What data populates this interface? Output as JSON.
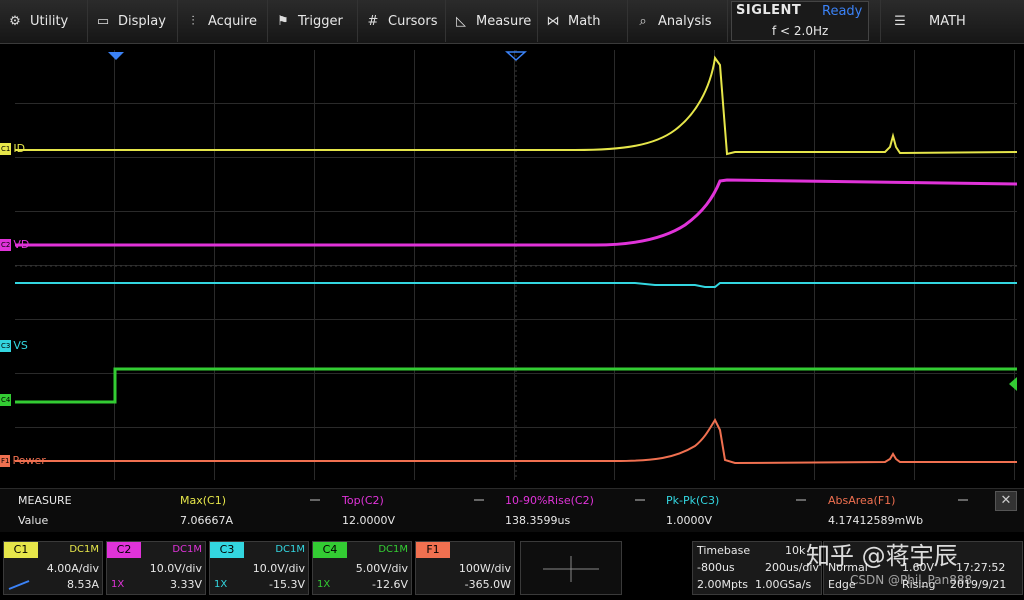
{
  "menu": [
    {
      "label": "Utility",
      "icon": "gear-icon",
      "glyph": "⚙"
    },
    {
      "label": "Display",
      "icon": "monitor-icon",
      "glyph": "▭"
    },
    {
      "label": "Acquire",
      "icon": "acquire-icon",
      "glyph": "⫶"
    },
    {
      "label": "Trigger",
      "icon": "flag-icon",
      "glyph": "⚑"
    },
    {
      "label": "Cursors",
      "icon": "cursors-icon",
      "glyph": "#"
    },
    {
      "label": "Measure",
      "icon": "measure-icon",
      "glyph": "◺"
    },
    {
      "label": "Math",
      "icon": "math-icon",
      "glyph": "⋈"
    },
    {
      "label": "Analysis",
      "icon": "analysis-icon",
      "glyph": "⌕"
    }
  ],
  "brand": {
    "logo": "SIGLENT",
    "status": "Ready",
    "freq": "f < 2.0Hz"
  },
  "math_menu": {
    "label": "MATH",
    "icon": "list-icon",
    "glyph": "☰"
  },
  "colors": {
    "c1": "#e6e64a",
    "c2": "#e033d9",
    "c3": "#33d6e0",
    "c4": "#33cc33",
    "f1": "#f07050",
    "accent": "#3b82f6"
  },
  "channels_labels": {
    "c1": "ID",
    "c2": "VD",
    "c3": "VS",
    "c4": "",
    "f1": "Power"
  },
  "channel_tags": {
    "c1": "C1",
    "c2": "C2",
    "c3": "C3",
    "c4": "C4",
    "f1": "F1"
  },
  "measure": {
    "title": "MEASURE",
    "row_label": "Value",
    "items": [
      {
        "name": "Max(C1)",
        "value": "7.06667A",
        "color": "#e6e64a"
      },
      {
        "name": "Top(C2)",
        "value": "12.0000V",
        "color": "#e033d9"
      },
      {
        "name": "10-90%Rise(C2)",
        "value": "138.3599us",
        "color": "#e033d9"
      },
      {
        "name": "Pk-Pk(C3)",
        "value": "1.0000V",
        "color": "#33d6e0"
      },
      {
        "name": "AbsArea(F1)",
        "value": "4.17412589mWb",
        "color": "#f07050"
      }
    ],
    "close": "✕"
  },
  "chboxes": [
    {
      "name": "C1",
      "coupling": "DC1M",
      "scale": "4.00A/div",
      "offset": "8.53A",
      "probe": "",
      "color": "#e6e64a"
    },
    {
      "name": "C2",
      "coupling": "DC1M",
      "scale": "10.0V/div",
      "offset": "3.33V",
      "probe": "1X",
      "color": "#e033d9"
    },
    {
      "name": "C3",
      "coupling": "DC1M",
      "scale": "10.0V/div",
      "offset": "-15.3V",
      "probe": "1X",
      "color": "#33d6e0"
    },
    {
      "name": "C4",
      "coupling": "DC1M",
      "scale": "5.00V/div",
      "offset": "-12.6V",
      "probe": "1X",
      "color": "#33cc33"
    },
    {
      "name": "F1",
      "coupling": "",
      "scale": "100W/div",
      "offset": "-365.0W",
      "probe": "",
      "color": "#f07050"
    }
  ],
  "timebase": {
    "title": "Timebase",
    "mpts_val": "10k",
    "delay": "-800us",
    "scale": "200us/div",
    "mpts": "2.00Mpts",
    "rate": "1.00GSa/s"
  },
  "trigger": {
    "mode": "Normal",
    "type": "Edge",
    "slope": "Rising",
    "level": "1.60V",
    "time": "17:27:52",
    "date": "2019/9/21"
  },
  "watermark": "知乎 @蒋宇辰",
  "csdn": "CSDN @Phil_Pan888"
}
